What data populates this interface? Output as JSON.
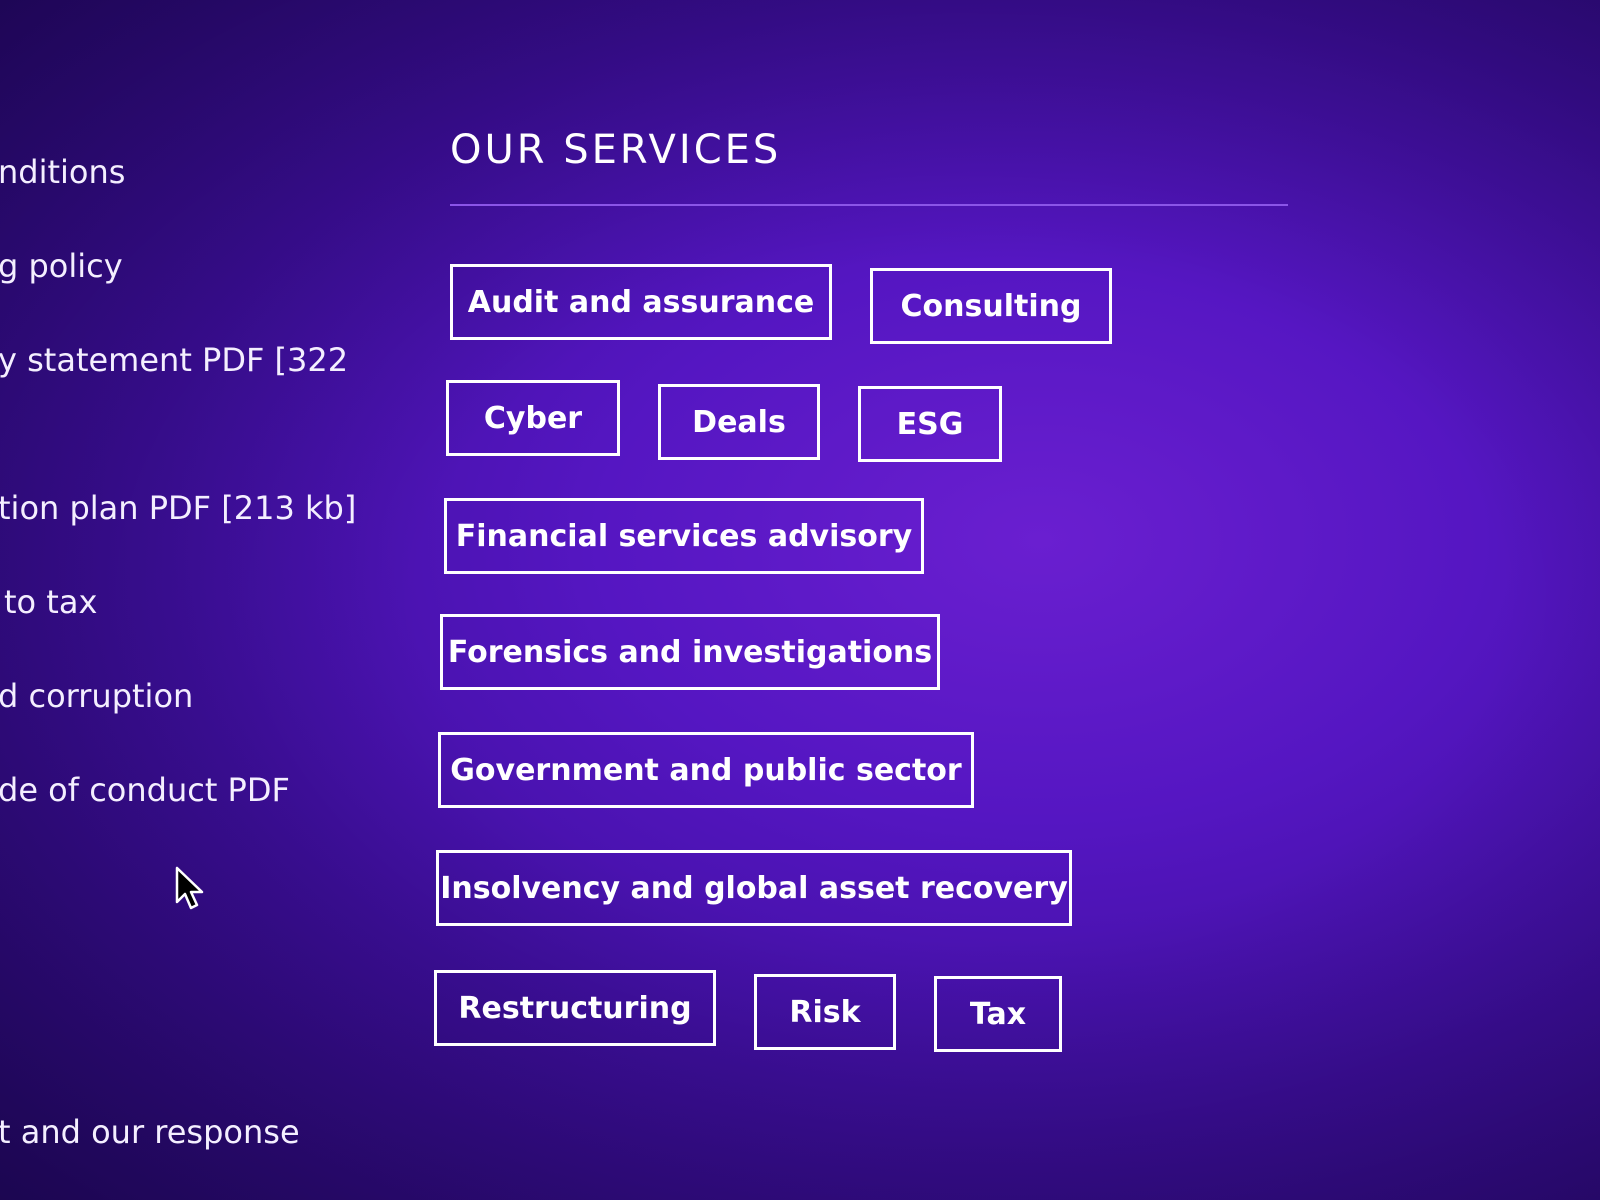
{
  "left_links": [
    "nditions",
    "g policy",
    "y statement PDF [322",
    "tion plan PDF [213 kb]",
    "to tax",
    "d corruption",
    "de of conduct PDF",
    "t and our response"
  ],
  "services": {
    "heading": "OUR SERVICES",
    "items": [
      "Audit and assurance",
      "Consulting",
      "Cyber",
      "Deals",
      "ESG",
      "Financial services advisory",
      "Forensics and investigations",
      "Government and public sector",
      "Insolvency and global asset recovery",
      "Restructuring",
      "Risk",
      "Tax"
    ]
  },
  "colors": {
    "background": "#5516c2",
    "button_border": "#ffffff",
    "divider": "#8b55e8"
  },
  "icons": {
    "cursor": "mouse-pointer-icon"
  }
}
